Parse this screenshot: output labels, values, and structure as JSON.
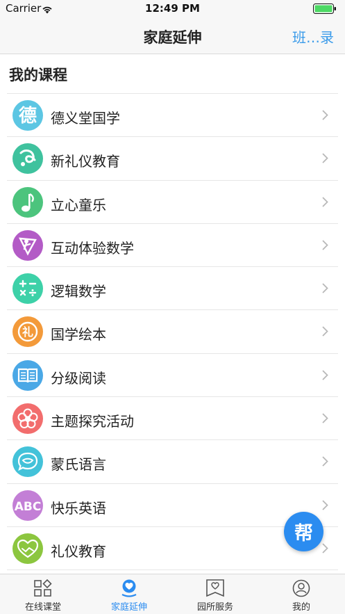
{
  "status_bar": {
    "carrier": "Carrier",
    "time": "12:49 PM"
  },
  "nav": {
    "title": "家庭延伸",
    "right_action": "班…录"
  },
  "section": {
    "title": "我的课程"
  },
  "courses": [
    {
      "label": "德义堂国学",
      "icon": "de-character-icon",
      "color": "#5cc6e3"
    },
    {
      "label": "新礼仪教育",
      "icon": "etiquette-logo-icon",
      "color": "#3fc29e"
    },
    {
      "label": "立心童乐",
      "icon": "music-note-icon",
      "color": "#4cc47d"
    },
    {
      "label": "互动体验数学",
      "icon": "math-figure-icon",
      "color": "#b35bc6"
    },
    {
      "label": "逻辑数学",
      "icon": "arithmetic-symbols-icon",
      "color": "#3dd1a8"
    },
    {
      "label": "国学绘本",
      "icon": "chinese-seal-icon",
      "color": "#f39a3a"
    },
    {
      "label": "分级阅读",
      "icon": "open-book-icon",
      "color": "#4aa8e6"
    },
    {
      "label": "主题探究活动",
      "icon": "flower-icon",
      "color": "#f26d6d"
    },
    {
      "label": "蒙氏语言",
      "icon": "speech-bubble-icon",
      "color": "#43c2d9"
    },
    {
      "label": "快乐英语",
      "icon": "abc-letters-icon",
      "color": "#c37fd6"
    },
    {
      "label": "礼仪教育",
      "icon": "handshake-heart-icon",
      "color": "#8cc63f"
    }
  ],
  "fab": {
    "label": "帮"
  },
  "tabs": [
    {
      "label": "在线课堂",
      "icon": "grid-icon",
      "active": false
    },
    {
      "label": "家庭延伸",
      "icon": "home-heart-icon",
      "active": true
    },
    {
      "label": "园所服务",
      "icon": "heart-flag-icon",
      "active": false
    },
    {
      "label": "我的",
      "icon": "profile-icon",
      "active": false
    }
  ],
  "colors": {
    "accent": "#2b8cf0",
    "link": "#3a9bea"
  }
}
